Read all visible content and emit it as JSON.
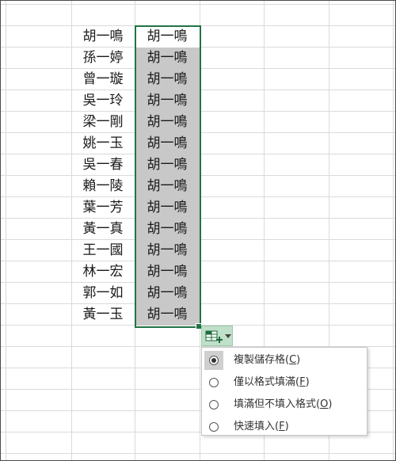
{
  "sheet": {
    "column_a": [
      "胡一鳴",
      "孫一婷",
      "曾一璇",
      "吳一玲",
      "梁一剛",
      "姚一玉",
      "吳一春",
      "賴一陵",
      "葉一芳",
      "黃一真",
      "王一國",
      "林一宏",
      "郭一如",
      "黃一玉"
    ],
    "column_b": [
      "胡一鳴",
      "胡一鳴",
      "胡一鳴",
      "胡一鳴",
      "胡一鳴",
      "胡一鳴",
      "胡一鳴",
      "胡一鳴",
      "胡一鳴",
      "胡一鳴",
      "胡一鳴",
      "胡一鳴",
      "胡一鳴",
      "胡一鳴"
    ]
  },
  "autofill": {
    "button_icon": "autofill-options-icon",
    "dropdown_icon": "chevron-down-icon",
    "options": [
      {
        "label": "複製儲存格",
        "key": "C",
        "selected": true
      },
      {
        "label": "僅以格式填滿",
        "key": "F",
        "selected": false
      },
      {
        "label": "填滿但不填入格式",
        "key": "O",
        "selected": false
      },
      {
        "label": "快速填入",
        "key": "F",
        "selected": false
      }
    ]
  },
  "colors": {
    "selection_border": "#217346",
    "fill_shade": "#c8c8c8",
    "button_bg": "#bfe0c9",
    "gridline": "#dadada"
  }
}
